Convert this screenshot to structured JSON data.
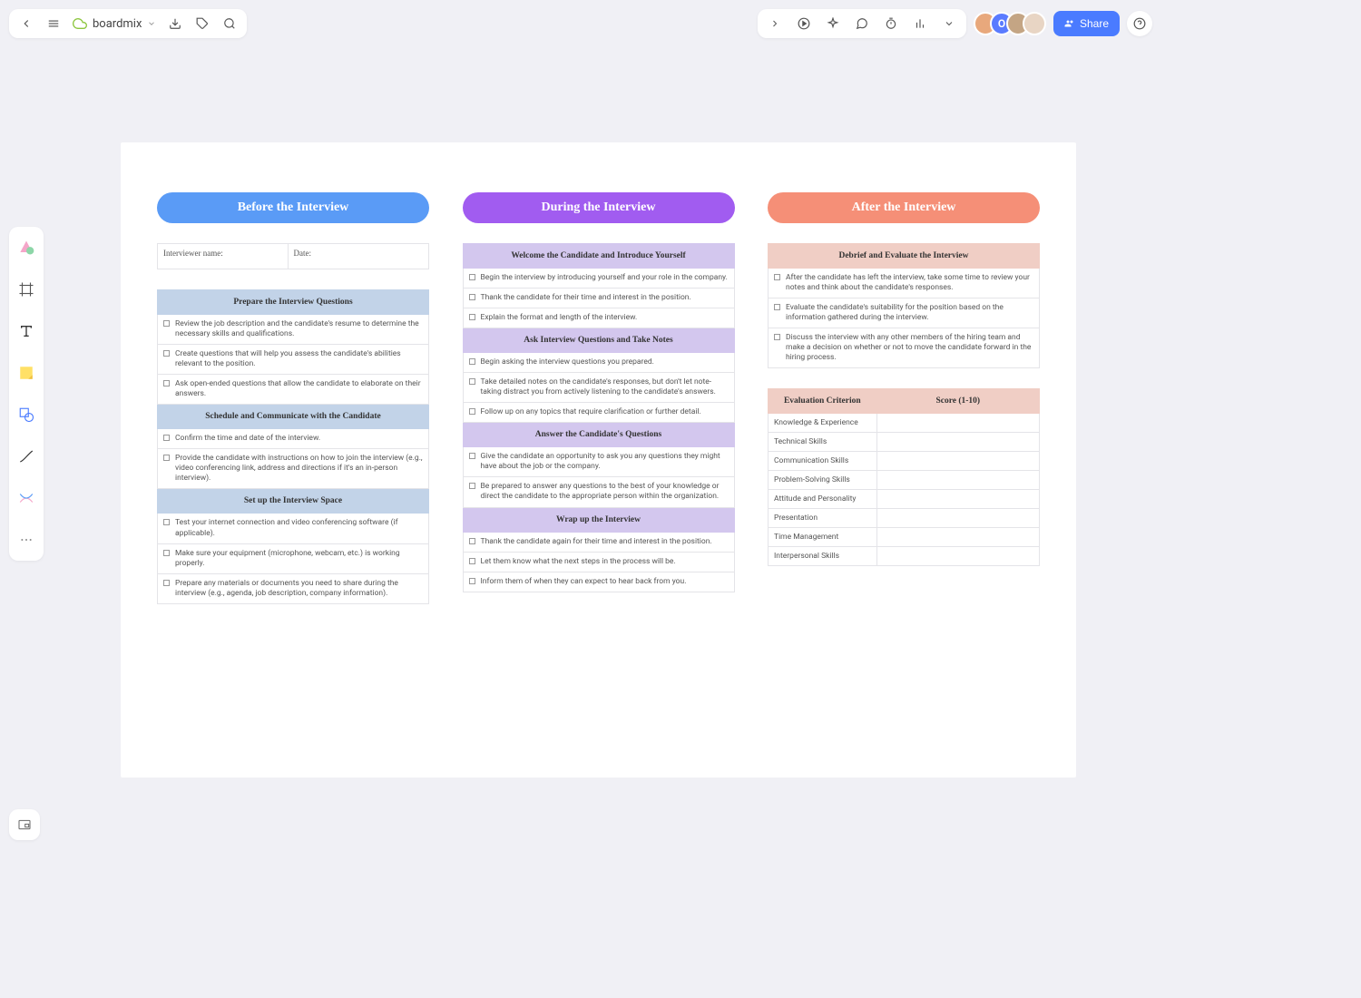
{
  "app": {
    "name": "boardmix"
  },
  "share_label": "Share",
  "columns": {
    "before": {
      "title": "Before the Interview",
      "fields": {
        "interviewer": "Interviewer name:",
        "date": "Date:"
      },
      "sections": [
        {
          "title": "Prepare the Interview Questions",
          "items": [
            "Review the job description and the candidate's resume to determine the necessary skills and qualifications.",
            "Create questions that will help you assess the candidate's abilities relevant to the position.",
            "Ask open-ended questions that allow the candidate to elaborate on their answers."
          ]
        },
        {
          "title": "Schedule and Communicate with the Candidate",
          "items": [
            "Confirm the time and date of the interview.",
            "Provide the candidate with instructions on how to join the interview (e.g., video conferencing link, address and directions if it's an in-person interview)."
          ]
        },
        {
          "title": "Set up the Interview Space",
          "items": [
            "Test your internet connection and video conferencing software (if applicable).",
            "Make sure your equipment (microphone, webcam, etc.) is working properly.",
            "Prepare any materials or documents you need to share during the interview (e.g., agenda, job description, company information)."
          ]
        }
      ]
    },
    "during": {
      "title": "During the Interview",
      "sections": [
        {
          "title": "Welcome the Candidate and Introduce Yourself",
          "items": [
            "Begin the interview by introducing yourself and your role in the company.",
            "Thank the candidate for their time and interest in the position.",
            "Explain the format and length of the interview."
          ]
        },
        {
          "title": "Ask Interview Questions and Take Notes",
          "items": [
            "Begin asking the interview questions you prepared.",
            "Take detailed notes on the candidate's responses, but don't let note-taking distract you from actively listening to the candidate's answers.",
            "Follow up on any topics that require clarification or further detail."
          ]
        },
        {
          "title": "Answer the Candidate's Questions",
          "items": [
            "Give the candidate an opportunity to ask you any questions they might have about the job or the company.",
            "Be prepared to answer any questions to the best of your knowledge or direct the candidate to the appropriate person within the organization."
          ]
        },
        {
          "title": "Wrap up the Interview",
          "items": [
            "Thank the candidate again for their time and interest in the position.",
            "Let them know what the next steps in the process will be.",
            "Inform them of when they can expect to hear back from you."
          ]
        }
      ]
    },
    "after": {
      "title": "After the Interview",
      "sections": [
        {
          "title": "Debrief and Evaluate the Interview",
          "items": [
            "After the candidate has left the interview, take some time to review your notes and think about the candidate's responses.",
            "Evaluate the candidate's suitability for the position based on the information gathered during the interview.",
            "Discuss the interview with any other members of the hiring team and make a decision on whether or not to move the candidate forward in the hiring process."
          ]
        }
      ],
      "eval": {
        "headers": [
          "Evaluation Criterion",
          "Score (1-10)"
        ],
        "rows": [
          "Knowledge & Experience",
          "Technical Skills",
          "Communication Skills",
          "Problem-Solving Skills",
          "Attitude and Personality",
          "Presentation",
          "Time Management",
          "Interpersonal Skills"
        ]
      }
    }
  }
}
